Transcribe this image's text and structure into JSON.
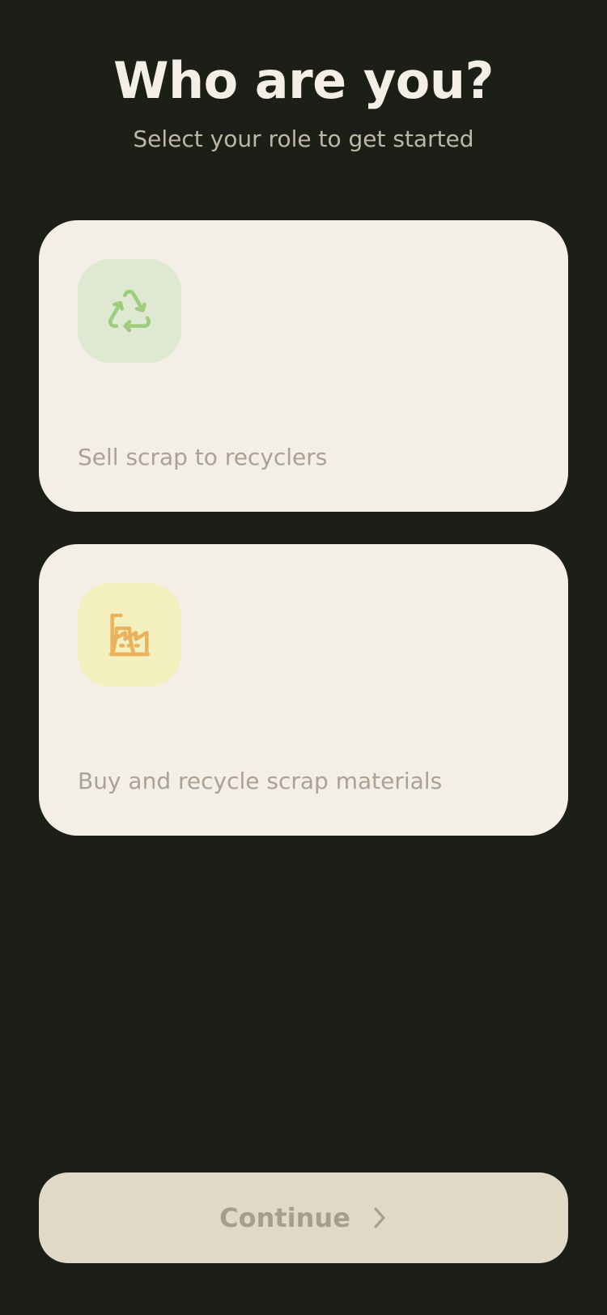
{
  "header": {
    "title": "Who are you?",
    "subtitle": "Select your role to get started"
  },
  "roles": [
    {
      "icon": "recycle-icon",
      "icon_color": "#9dcc7d",
      "tile_color": "#dfe8d0",
      "label": "",
      "description": "Sell scrap to recyclers"
    },
    {
      "icon": "factory-icon",
      "icon_color": "#ebb25e",
      "tile_color": "#f4efbf",
      "label": "",
      "description": "Buy and recycle scrap materials"
    }
  ],
  "footer": {
    "continue_label": "Continue",
    "continue_icon": "chevron-right-icon",
    "continue_disabled": true
  },
  "colors": {
    "background": "#1b1f17",
    "card": "#f3efe6",
    "button": "#e0d9c6"
  }
}
